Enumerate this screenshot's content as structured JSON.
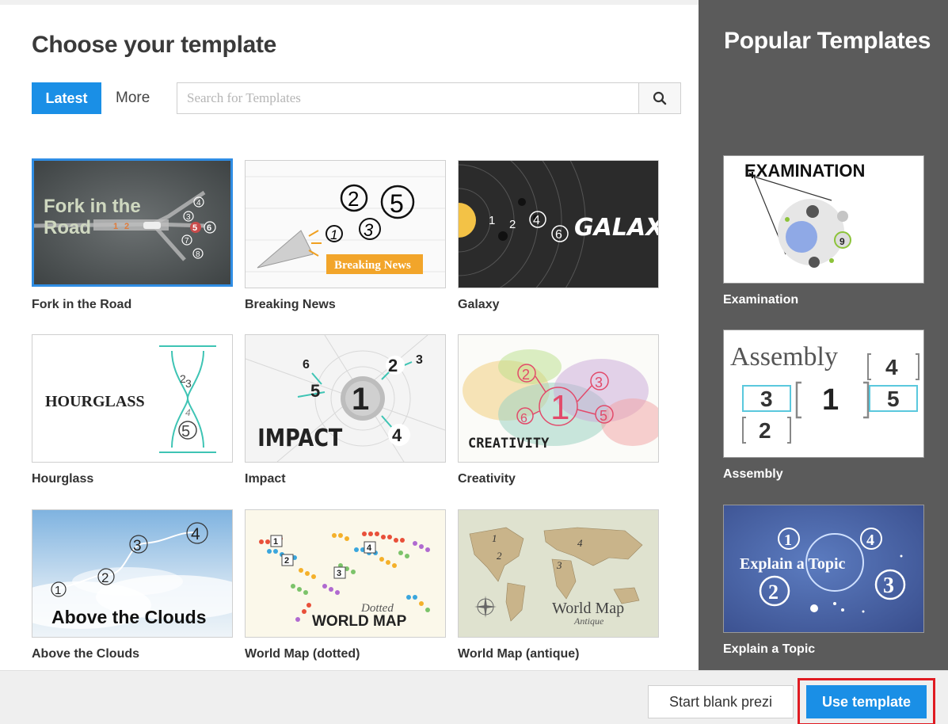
{
  "header": {
    "title": "Choose your template",
    "tabs": [
      {
        "label": "Latest",
        "active": true
      },
      {
        "label": "More",
        "active": false
      }
    ],
    "search": {
      "placeholder": "Search for Templates",
      "value": ""
    }
  },
  "templates": [
    {
      "name": "Fork in the Road",
      "selected": true,
      "thumb_text": {
        "title_line1": "Fork in the",
        "title_line2": "Road",
        "n1": "1",
        "n2": "2",
        "n3": "3",
        "n4": "4",
        "n5": "5",
        "n6": "6",
        "n7": "7",
        "n8": "8"
      }
    },
    {
      "name": "Breaking News",
      "thumb_text": {
        "banner": "Breaking News",
        "n1": "1",
        "n2": "2",
        "n3": "3",
        "n5": "5"
      }
    },
    {
      "name": "Galaxy",
      "thumb_text": {
        "title": "GALAXY",
        "n1": "1",
        "n2": "2",
        "n4": "4",
        "n6": "6"
      }
    },
    {
      "name": "Hourglass",
      "thumb_text": {
        "title": "HOURGLASS",
        "n2": "2",
        "n3": "3",
        "n4": "4",
        "n5": "5"
      }
    },
    {
      "name": "Impact",
      "thumb_text": {
        "title": "IMPACT",
        "n1": "1",
        "n2": "2",
        "n3": "3",
        "n4": "4",
        "n5": "5",
        "n6": "6"
      }
    },
    {
      "name": "Creativity",
      "thumb_text": {
        "title": "CREATIVITY",
        "n1": "1",
        "n2": "2",
        "n3": "3",
        "n5": "5",
        "n6": "6"
      }
    },
    {
      "name": "Above the Clouds",
      "thumb_text": {
        "title": "Above the Clouds",
        "n1": "1",
        "n2": "2",
        "n3": "3",
        "n4": "4"
      }
    },
    {
      "name": "World Map (dotted)",
      "thumb_text": {
        "title_line1": "Dotted",
        "title_line2": "WORLD MAP",
        "n1": "1",
        "n2": "2",
        "n3": "3",
        "n4": "4"
      }
    },
    {
      "name": "World Map (antique)",
      "thumb_text": {
        "title_line1": "World Map",
        "title_line2": "Antique",
        "n1": "1",
        "n2": "2",
        "n3": "3",
        "n4": "4"
      }
    }
  ],
  "popular": {
    "title": "Popular Templates",
    "items": [
      {
        "name": "Examination",
        "thumb_text": {
          "title": "EXAMINATION",
          "n9": "9"
        }
      },
      {
        "name": "Assembly",
        "thumb_text": {
          "title": "Assembly",
          "n1": "1",
          "n2": "2",
          "n3": "3",
          "n4": "4",
          "n5": "5"
        }
      },
      {
        "name": "Explain a Topic",
        "thumb_text": {
          "title": "Explain a Topic",
          "n1": "1",
          "n2": "2",
          "n3": "3",
          "n4": "4"
        }
      }
    ]
  },
  "footer": {
    "blank_label": "Start blank prezi",
    "use_label": "Use template"
  },
  "colors": {
    "accent": "#1a8fe6",
    "sidebar_bg": "#5b5b5b",
    "highlight_outline": "#e01b22",
    "selected_border": "#2f8de4"
  },
  "icons": {
    "search": "magnifier-icon"
  }
}
